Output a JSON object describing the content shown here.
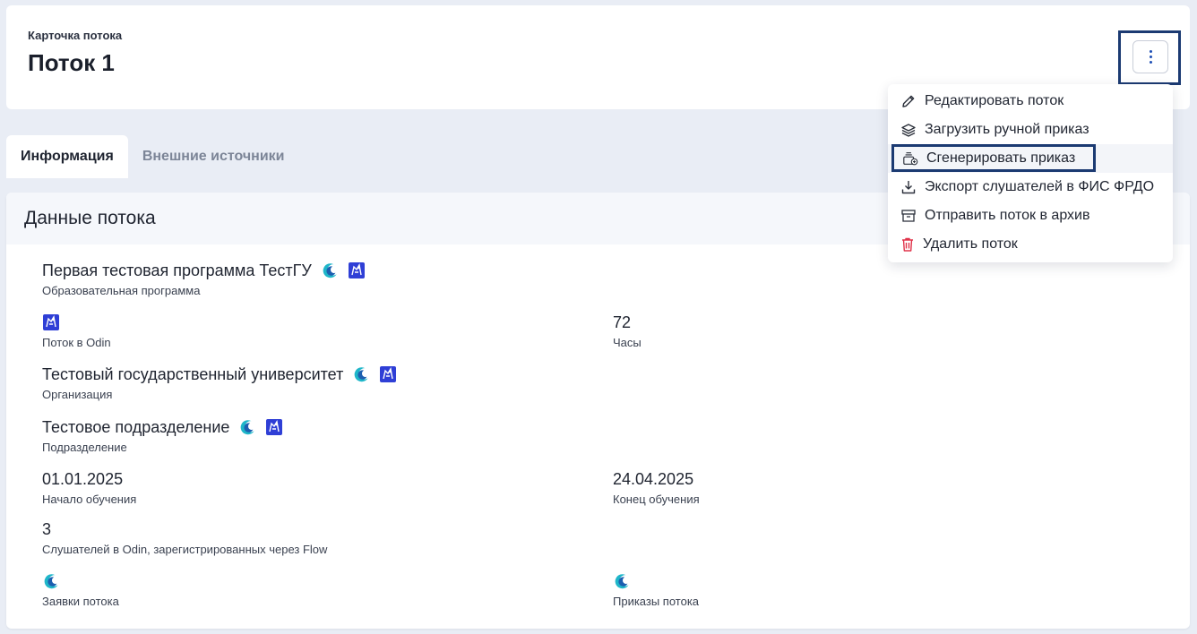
{
  "header": {
    "eyebrow": "Карточка потока",
    "title": "Поток 1"
  },
  "tabs": [
    "Информация",
    "Внешние источники"
  ],
  "section_title": "Данные потока",
  "fields": {
    "program": {
      "value": "Первая тестовая программа ТестГУ",
      "label": "Образовательная программа"
    },
    "odin_stream": {
      "label": "Поток в Odin"
    },
    "hours": {
      "value": "72",
      "label": "Часы"
    },
    "organization": {
      "value": "Тестовый государственный университет",
      "label": "Организация"
    },
    "department": {
      "value": "Тестовое подразделение",
      "label": "Подразделение"
    },
    "start": {
      "value": "01.01.2025",
      "label": "Начало обучения"
    },
    "end": {
      "value": "24.04.2025",
      "label": "Конец обучения"
    },
    "listeners": {
      "value": "3",
      "label": "Слушателей в Odin, зарегистрированных через Flow"
    },
    "requests": {
      "label": "Заявки потока"
    },
    "orders": {
      "label": "Приказы потока"
    }
  },
  "menu": [
    {
      "label": "Редактировать поток",
      "icon": "pencil-icon"
    },
    {
      "label": "Загрузить ручной приказ",
      "icon": "layers-icon"
    },
    {
      "label": "Сгенерировать приказ",
      "icon": "generate-order-icon"
    },
    {
      "label": "Экспорт слушателей в ФИС ФРДО",
      "icon": "download-icon"
    },
    {
      "label": "Отправить поток в архив",
      "icon": "archive-icon"
    },
    {
      "label": "Удалить поток",
      "icon": "trash-icon"
    }
  ],
  "colors": {
    "accent": "#1b3a72",
    "danger": "#e0334a",
    "odin": "#2f3fd6",
    "flow": "#2aa8c9"
  }
}
